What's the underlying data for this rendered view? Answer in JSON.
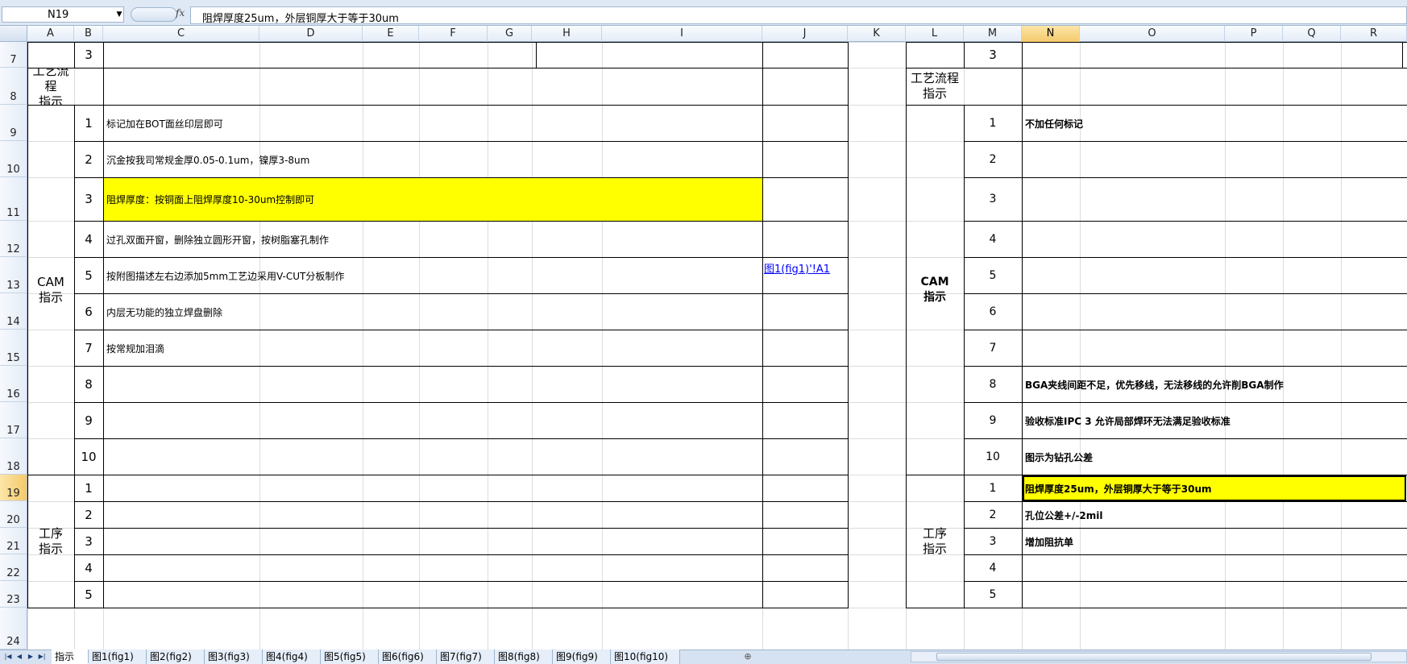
{
  "formula_bar": {
    "name_box": "N19",
    "fx": "fx",
    "formula": "阻焊厚度25um，外层铜厚大于等于30um"
  },
  "columns": [
    "A",
    "B",
    "C",
    "D",
    "E",
    "F",
    "G",
    "H",
    "I",
    "J",
    "K",
    "L",
    "M",
    "N",
    "O",
    "P",
    "Q",
    "R"
  ],
  "rows": [
    "7",
    "8",
    "9",
    "10",
    "11",
    "12",
    "13",
    "14",
    "15",
    "16",
    "17",
    "18",
    "19",
    "20",
    "21",
    "22",
    "23",
    "24"
  ],
  "left": {
    "row7_num": "3",
    "process_label": "工艺流程\n指示",
    "cam_label": "CAM\n指示",
    "cam_items": [
      {
        "n": "1",
        "text": "标记加在BOT面丝印层即可"
      },
      {
        "n": "2",
        "text": "沉金按我司常规金厚0.05-0.1um，镍厚3-8um"
      },
      {
        "n": "3",
        "text": "阻焊厚度：按铜面上阻焊厚度10-30um控制即可"
      },
      {
        "n": "4",
        "text": "过孔双面开窗，删除独立圆形开窗，按树脂塞孔制作"
      },
      {
        "n": "5",
        "text": "按附图描述左右边添加5mm工艺边采用V-CUT分板制作"
      },
      {
        "n": "6",
        "text": "内层无功能的独立焊盘删除"
      },
      {
        "n": "7",
        "text": "按常规加泪滴"
      },
      {
        "n": "8",
        "text": ""
      },
      {
        "n": "9",
        "text": ""
      },
      {
        "n": "10",
        "text": ""
      }
    ],
    "link_text": "图1(fig1)'!A1",
    "proc_label": "工序\n指示",
    "proc_items": [
      "1",
      "2",
      "3",
      "4",
      "5"
    ]
  },
  "right": {
    "row7_num": "3",
    "process_label": "工艺流程\n指示",
    "cam_label": "CAM\n指示",
    "cam_items": [
      {
        "n": "1",
        "text": "不加任何标记"
      },
      {
        "n": "2",
        "text": ""
      },
      {
        "n": "3",
        "text": ""
      },
      {
        "n": "4",
        "text": ""
      },
      {
        "n": "5",
        "text": ""
      },
      {
        "n": "6",
        "text": ""
      },
      {
        "n": "7",
        "text": ""
      },
      {
        "n": "8",
        "text": "BGA夹线间距不足，优先移线，无法移线的允许削BGA制作"
      },
      {
        "n": "9",
        "text": "验收标准IPC 3   允许局部焊环无法满足验收标准"
      },
      {
        "n": "10",
        "text": "图示为钻孔公差"
      }
    ],
    "proc_label": "工序\n指示",
    "proc_items": [
      {
        "n": "1",
        "text": "阻焊厚度25um，外层铜厚大于等于30um"
      },
      {
        "n": "2",
        "text": "孔位公差+/-2mil"
      },
      {
        "n": "3",
        "text": "增加阻抗单"
      },
      {
        "n": "4",
        "text": ""
      },
      {
        "n": "5",
        "text": ""
      }
    ]
  },
  "tabs": [
    "指示",
    "图1(fig1)",
    "图2(fig2)",
    "图3(fig3)",
    "图4(fig4)",
    "图5(fig5)",
    "图6(fig6)",
    "图7(fig7)",
    "图8(fig8)",
    "图9(fig9)",
    "图10(fig10)"
  ],
  "colors": {
    "highlight": "#ffff00",
    "selected_header": "#f5c96b",
    "link": "#0000ff"
  }
}
